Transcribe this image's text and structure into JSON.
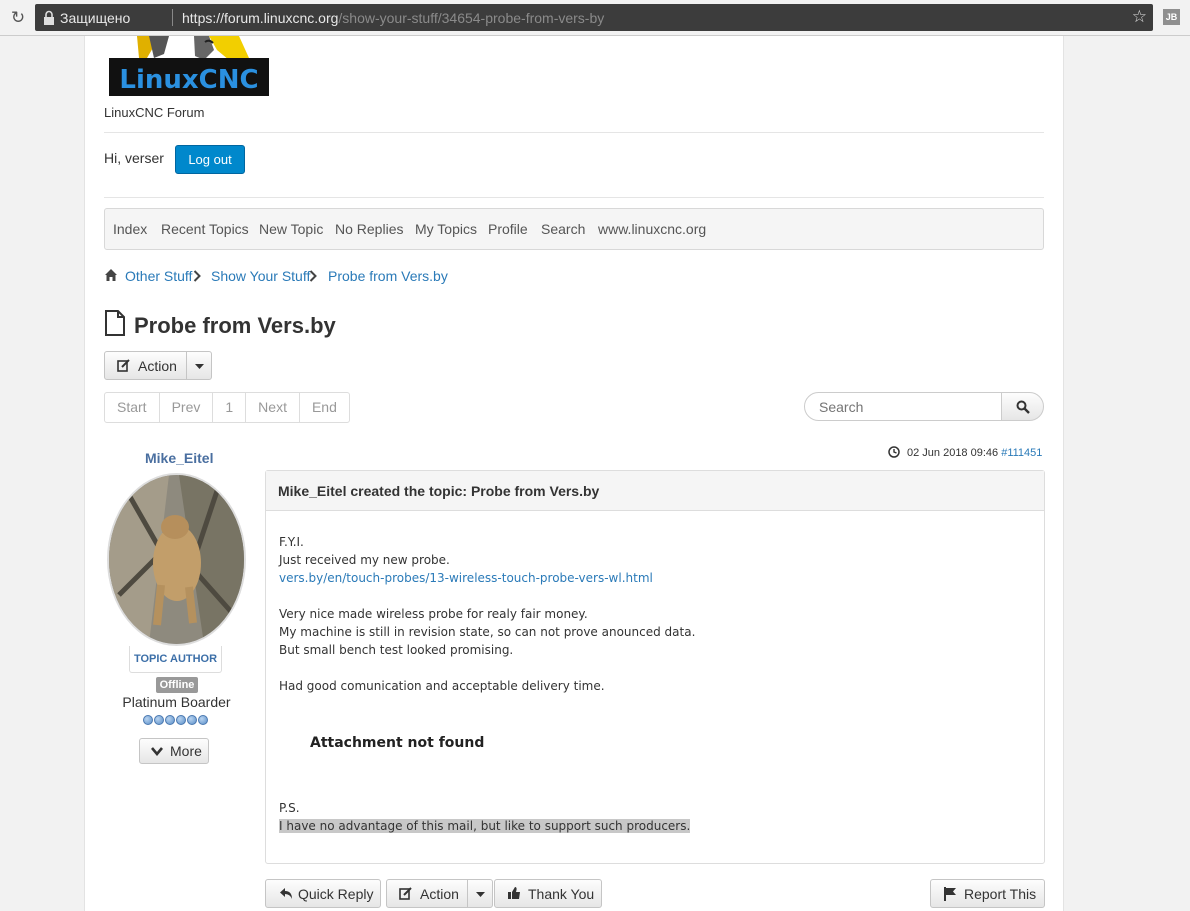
{
  "browser": {
    "secure_label": "Защищено",
    "url_host": "https://forum.linuxcnc.org",
    "url_path": "/show-your-stuff/34654-probe-from-vers-by",
    "extension_label": "JB"
  },
  "site": {
    "logo_text": "LinuxCNC",
    "name": "LinuxCNC Forum",
    "greeting": "Hi, verser",
    "logout_label": "Log out"
  },
  "nav": {
    "items": [
      "Index",
      "Recent Topics",
      "New Topic",
      "No Replies",
      "My Topics",
      "Profile",
      "Search",
      "www.linuxcnc.org"
    ]
  },
  "breadcrumb": [
    "Other Stuff",
    "Show Your Stuff",
    "Probe from Vers.by"
  ],
  "topic": {
    "title": "Probe from Vers.by",
    "action_label": "Action"
  },
  "pagination": [
    "Start",
    "Prev",
    "1",
    "Next",
    "End"
  ],
  "search": {
    "placeholder": "Search"
  },
  "post": {
    "author": "Mike_Eitel",
    "role": "TOPIC AUTHOR",
    "status": "Offline",
    "rank": "Platinum Boarder",
    "more_label": "More",
    "datetime": "02 Jun 2018 09:46",
    "post_id": "#111451",
    "header": "Mike_Eitel created the topic: Probe from Vers.by",
    "lines": [
      "F.Y.I.",
      "Just received my new probe."
    ],
    "link": "vers.by/en/touch-probes/13-wireless-touch-probe-vers-wl.html",
    "paragraph2": [
      "Very nice made wireless probe for realy fair money.",
      "My machine is still in revision state, so can not prove anounced data.",
      "But small bench test looked promising."
    ],
    "paragraph3": "Had good comunication and acceptable delivery time.",
    "attachment": "Attachment not found",
    "ps_label": "P.S.",
    "ps_text": "I have no advantage of this mail, but like to support such producers."
  },
  "post_actions": {
    "quick_reply": "Quick Reply",
    "action": "Action",
    "thank_you": "Thank You",
    "report": "Report This"
  }
}
